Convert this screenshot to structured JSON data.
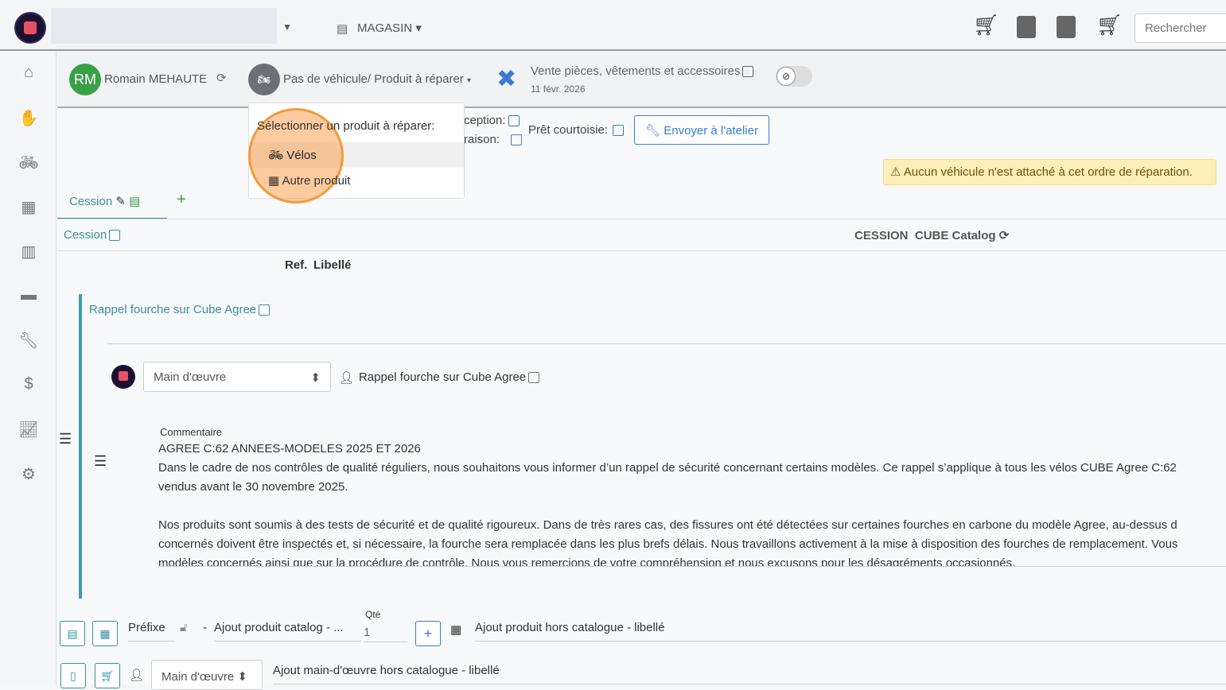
{
  "topbar": {
    "store_label": "MAGASIN",
    "search_placeholder": "Rechercher"
  },
  "header": {
    "avatar_initials": "RM",
    "customer_name": "Romain MEHAUTE",
    "vehicle_label": "Pas de véhicule/ Produit à réparer",
    "order_type": "Vente pièces, vêtements et accessoires",
    "date": "11 févr. 2026"
  },
  "dropdown": {
    "title": "Sélectionner un produit à réparer:",
    "items": [
      {
        "label": "Vélos"
      },
      {
        "label": "Autre produit"
      }
    ]
  },
  "info": {
    "reception": "ception:",
    "livraison": "raison:",
    "courtesy": "Prêt courtoisie:",
    "send_button": "Envoyer à l'atelier",
    "warning": "Aucun véhicule n'est attaché à cet ordre de réparation."
  },
  "tabs": {
    "cession": "Cession",
    "add": "+"
  },
  "section": {
    "title": "Cession",
    "right_label": "CESSION",
    "catalog": "CUBE Catalog",
    "col_ref": "Ref.",
    "col_label": "Libellé"
  },
  "group": {
    "title": "Rappel fourche sur Cube Agree",
    "line_type": "Main d'œuvre",
    "line_label": "Rappel fourche sur Cube Agree",
    "comment_label": "Commentaire",
    "comment_lines": [
      "AGREE C:62 ANNEES-MODELES 2025 ET 2026",
      "Dans le cadre de nos contrôles de qualité réguliers, nous souhaitons vous informer d’un rappel de sécurité concernant certains modèles. Ce rappel s’applique à tous les vélos CUBE Agree C:62",
      "vendus avant le 30 novembre 2025.",
      "",
      "Nos produits sont soumis à des tests de sécurité et de qualité rigoureux. Dans de très rares cas, des fissures ont été détectées sur certaines fourches en carbone du modèle Agree, au-dessus d",
      "concernés doivent être inspectés et, si nécessaire, la fourche sera remplacée dans les plus brefs délais. Nous travaillons activement à la mise à disposition des fourches de remplacement. Vous",
      "modèles concernés ainsi que sur la procédure de contrôle. Nous vous remercions de votre compréhension et nous excusons pour les désagréments occasionnés."
    ]
  },
  "footer": {
    "prefix": "Préfixe",
    "catalog_placeholder": "Ajout produit catalog - ...",
    "qty_label": "Qté",
    "qty": "1",
    "offcatalog_placeholder": "Ajout produit hors catalogue - libellé",
    "labor_type": "Main d'œuvre",
    "labor_placeholder": "Ajout main-d'œuvre hors catalogue - libellé"
  }
}
